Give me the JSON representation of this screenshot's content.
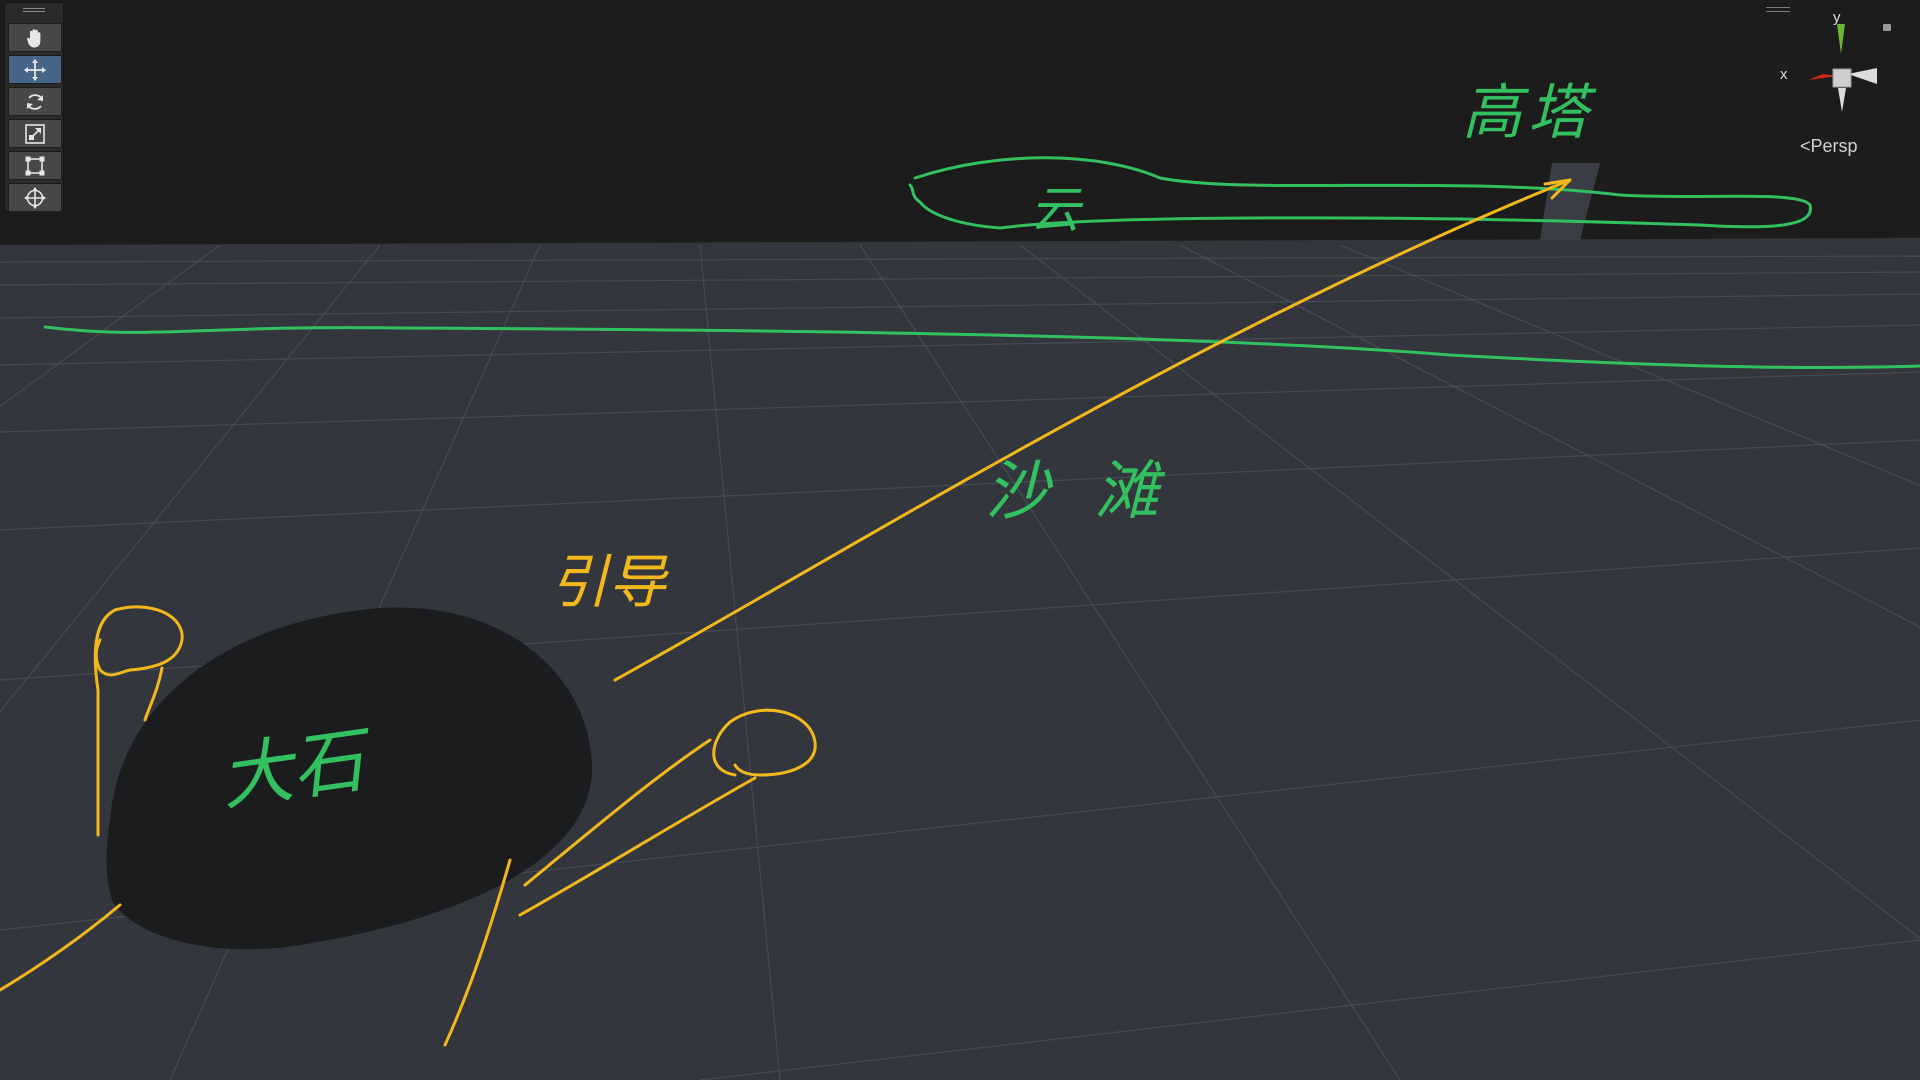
{
  "toolbar": {
    "tools": [
      {
        "name": "hand-tool-button",
        "icon": "hand-icon",
        "active": false
      },
      {
        "name": "move-tool-button",
        "icon": "move-icon",
        "active": true
      },
      {
        "name": "rotate-tool-button",
        "icon": "rotate-icon",
        "active": false
      },
      {
        "name": "scale-tool-button",
        "icon": "scale-icon",
        "active": false
      },
      {
        "name": "rect-tool-button",
        "icon": "rect-transform-icon",
        "active": false
      },
      {
        "name": "transform-tool-button",
        "icon": "transform-icon",
        "active": false
      }
    ]
  },
  "gizmo": {
    "y_label": "y",
    "x_label": "x",
    "projection_label": "<Persp"
  },
  "annotations": {
    "tower": "高塔",
    "cloud": "云",
    "beach": "沙 滩",
    "guide": "引导",
    "boulder": "大石",
    "green_color": "#33c060",
    "yellow_color": "#f2b81c"
  },
  "colors": {
    "sky": "#1c1c1c",
    "ground": "#33373d",
    "grid": "#474c53",
    "boulder": "#1b1c1e",
    "toolbar_active": "#486587"
  }
}
